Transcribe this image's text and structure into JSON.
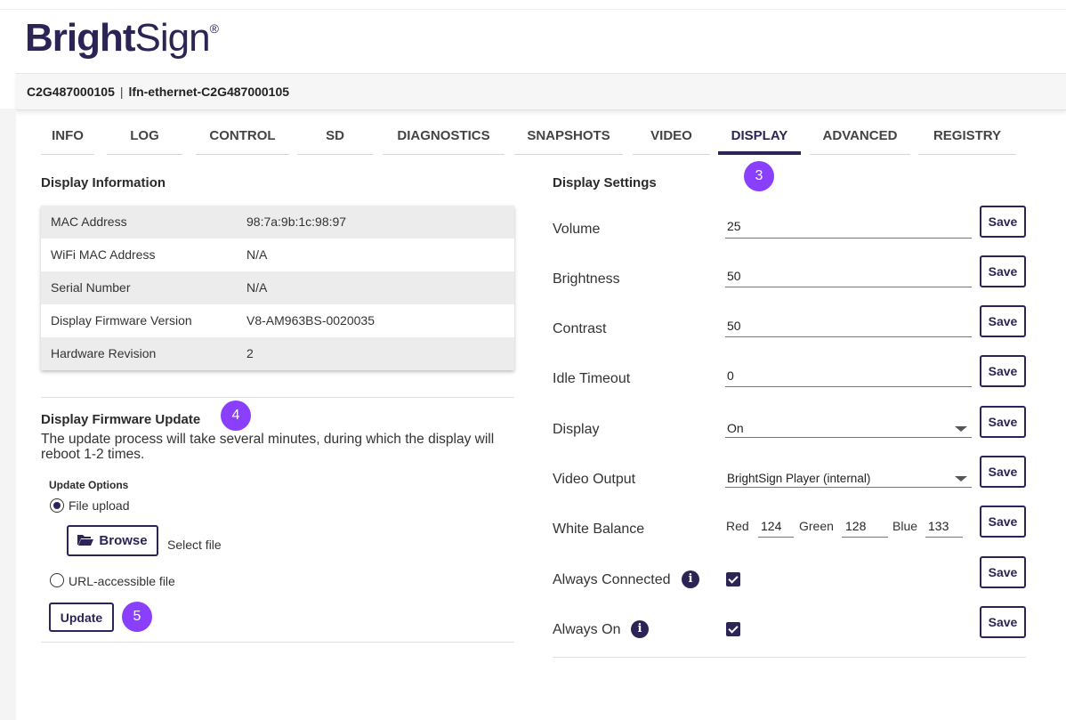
{
  "brand": {
    "logo_bold": "Bright",
    "logo_light": "Sign",
    "registered": "®"
  },
  "device": {
    "serial": "C2G487000105",
    "separator": "|",
    "name": "lfn-ethernet-C2G487000105"
  },
  "tabs": [
    {
      "label": "INFO"
    },
    {
      "label": "LOG"
    },
    {
      "label": "CONTROL"
    },
    {
      "label": "SD"
    },
    {
      "label": "DIAGNOSTICS"
    },
    {
      "label": "SNAPSHOTS"
    },
    {
      "label": "VIDEO"
    },
    {
      "label": "DISPLAY",
      "active": true
    },
    {
      "label": "ADVANCED"
    },
    {
      "label": "REGISTRY"
    }
  ],
  "badges": {
    "b3": "3",
    "b4": "4",
    "b5": "5"
  },
  "display_info": {
    "title": "Display Information",
    "rows": [
      {
        "key": "MAC Address",
        "value": "98:7a:9b:1c:98:97"
      },
      {
        "key": "WiFi MAC Address",
        "value": "N/A"
      },
      {
        "key": "Serial Number",
        "value": "N/A"
      },
      {
        "key": "Display Firmware Version",
        "value": "V8-AM963BS-0020035"
      },
      {
        "key": "Hardware Revision",
        "value": "2"
      }
    ]
  },
  "firmware_update": {
    "title": "Display Firmware Update",
    "description": "The update process will take several minutes, during which the display will reboot 1-2 times.",
    "options_label": "Update Options",
    "opt_file": "File upload",
    "opt_url": "URL-accessible file",
    "browse_label": "Browse",
    "select_file": "Select file",
    "update_label": "Update"
  },
  "display_settings": {
    "title": "Display Settings",
    "save_label": "Save",
    "volume": {
      "label": "Volume",
      "value": "25"
    },
    "brightness": {
      "label": "Brightness",
      "value": "50"
    },
    "contrast": {
      "label": "Contrast",
      "value": "50"
    },
    "idle_timeout": {
      "label": "Idle Timeout",
      "value": "0"
    },
    "display": {
      "label": "Display",
      "value": "On"
    },
    "video_output": {
      "label": "Video Output",
      "value": "BrightSign Player (internal)"
    },
    "white_balance": {
      "label": "White Balance",
      "red_label": "Red",
      "red": "124",
      "green_label": "Green",
      "green": "128",
      "blue_label": "Blue",
      "blue": "133"
    },
    "always_connected": {
      "label": "Always Connected",
      "checked": true
    },
    "always_on": {
      "label": "Always On",
      "checked": true
    }
  },
  "icons": {
    "info": "i"
  }
}
